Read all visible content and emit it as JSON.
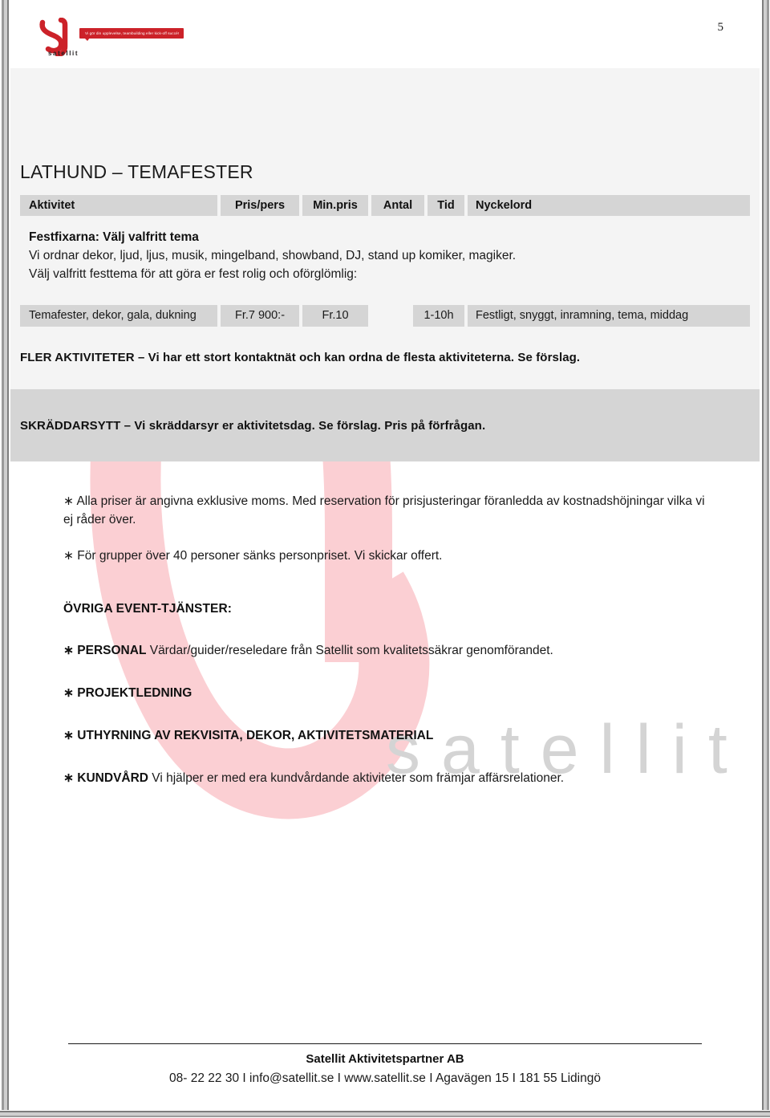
{
  "page": {
    "number": "5"
  },
  "logo": {
    "wordmark": "satellit",
    "tagline": "Vi gör din upplevelse, teambuilding eller kick-off succé!",
    "mark_name": "satellit-s-swoosh"
  },
  "document": {
    "title": "LATHUND – TEMAFESTER"
  },
  "table": {
    "headers": {
      "aktivitet": "Aktivitet",
      "pris_pers": "Pris/pers",
      "min_pris": "Min.pris",
      "antal": "Antal",
      "tid": "Tid",
      "nyckelord": "Nyckelord"
    },
    "intro": {
      "lead": "Festfixarna: Välj valfritt tema",
      "line1": "Vi ordnar dekor, ljud, ljus, musik, mingelband, showband, DJ, stand up komiker, magiker.",
      "line2": "Välj valfritt festtema för att göra er fest rolig och oförglömlig:"
    },
    "row": {
      "aktivitet": "Temafester, dekor, gala, dukning",
      "pris_pers": "Fr.7 900:-",
      "min_pris": "Fr.10",
      "antal": "",
      "tid": "1-10h",
      "nyckelord": "Festligt, snyggt, inramning, tema, middag"
    }
  },
  "statements": {
    "fler_aktiviteter": "FLER AKTIVITETER – Vi har ett stort kontaktnät och kan ordna de flesta aktiviteterna. Se förslag.",
    "skraddarsytt": "SKRÄDDARSYTT – Vi skräddarsyr er aktivitetsdag. Se förslag. Pris på förfrågan."
  },
  "notes": [
    "∗ Alla priser är angivna exklusive moms. Med reservation för prisjusteringar föranledda av kostnadshöjningar vilka vi ej råder över.",
    "∗ För grupper över 40 personer sänks personpriset. Vi skickar offert."
  ],
  "services": {
    "heading": "ÖVRIGA EVENT-TJÄNSTER:",
    "items": [
      {
        "label": "∗ PERSONAL",
        "text": " Värdar/guider/reseledare från Satellit som kvalitetssäkrar genomförandet."
      },
      {
        "label": "∗ PROJEKTLEDNING",
        "text": ""
      },
      {
        "label": "∗ UTHYRNING AV REKVISITA, DEKOR, AKTIVITETSMATERIAL",
        "text": ""
      },
      {
        "label": "∗ KUNDVÅRD",
        "text": " Vi hjälper er med era kundvårdande aktiviteter som främjar affärsrelationer."
      }
    ]
  },
  "footer": {
    "company": "Satellit Aktivitetspartner AB",
    "contact": "08- 22 22 30  I  info@satellit.se  I  www.satellit.se  I  Agavägen 15  I  181 55 Lidingö"
  },
  "watermarks": {
    "word": "satellit",
    "swoosh_name": "satellit-s-watermark"
  },
  "colors": {
    "brand_red": "#cc2229",
    "band_gray": "#d5d5d5",
    "page_gray": "#f4f4f4",
    "watermark_pink": "#fbcfd3",
    "watermark_gray": "#d4d4d4"
  }
}
